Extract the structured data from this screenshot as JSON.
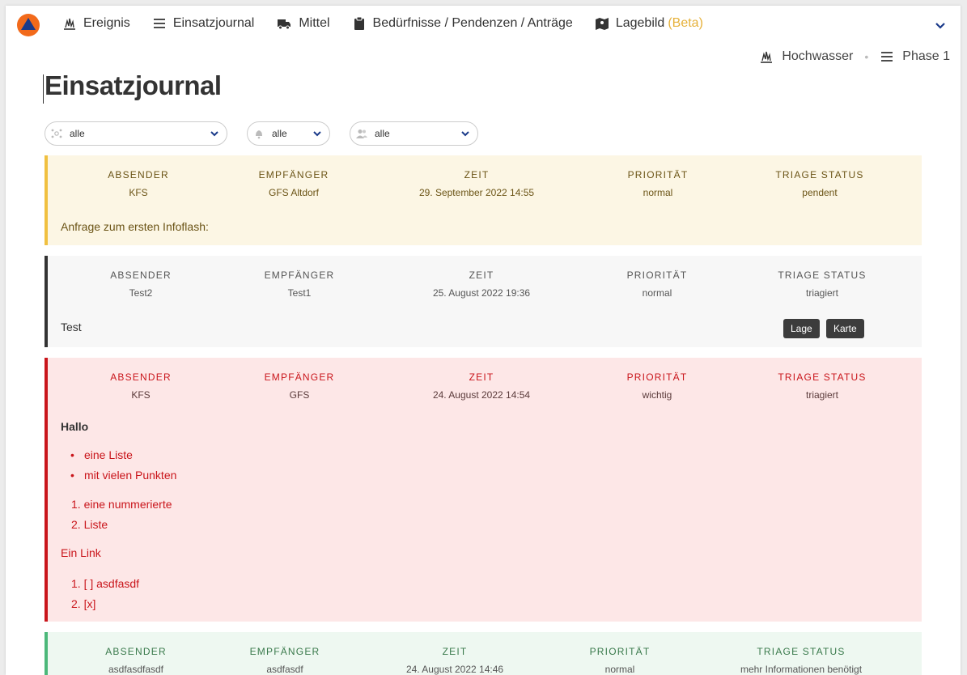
{
  "nav": {
    "items": [
      {
        "label": "Ereignis",
        "icon": "fire-icon"
      },
      {
        "label": "Einsatzjournal",
        "icon": "list-icon"
      },
      {
        "label": "Mittel",
        "icon": "truck-icon"
      },
      {
        "label": "Bedürfnisse / Pendenzen / Anträge",
        "icon": "clipboard-icon"
      },
      {
        "label": "Lagebild",
        "icon": "map-icon",
        "suffix": "(Beta)"
      }
    ]
  },
  "context": {
    "event": "Hochwasser",
    "phase": "Phase 1"
  },
  "page_title": "Einsatzjournal",
  "filters": [
    {
      "icon": "network-icon",
      "value": "alle"
    },
    {
      "icon": "bell-icon",
      "value": "alle"
    },
    {
      "icon": "users-icon",
      "value": "alle"
    }
  ],
  "columns": {
    "sender": "ABSENDER",
    "receiver": "EMPFÄNGER",
    "time": "ZEIT",
    "priority": "PRIORITÄT",
    "triage": "TRIAGE STATUS"
  },
  "entries": [
    {
      "sender": "KFS",
      "receiver": "GFS Altdorf",
      "time": "29. September 2022 14:55",
      "priority": "normal",
      "triage": "pendent",
      "text": "Anfrage zum ersten Infoflash:"
    },
    {
      "sender": "Test2",
      "receiver": "Test1",
      "time": "25. August 2022 19:36",
      "priority": "normal",
      "triage": "triagiert",
      "text": "Test",
      "tags": [
        "Lage",
        "Karte"
      ]
    },
    {
      "sender": "KFS",
      "receiver": "GFS",
      "time": "24. August 2022 14:54",
      "priority": "wichtig",
      "triage": "triagiert",
      "heading": "Hallo",
      "bullets": [
        "eine Liste",
        "mit vielen Punkten"
      ],
      "numbered": [
        "1. eine nummerierte",
        "2. Liste"
      ],
      "link": "Ein Link",
      "tasks": [
        "1. [ ] asdfasdf",
        "2. [x]"
      ]
    },
    {
      "sender": "asdfasdfasdf",
      "receiver": "asdfasdf",
      "time": "24. August 2022 14:46",
      "priority": "normal",
      "triage": "mehr Informationen benötigt"
    }
  ],
  "colors": {
    "yellow_bg": "#fcf6e4",
    "yellow_bar": "#f0c040",
    "grey_bg": "#f7f7f7",
    "grey_bar": "#333333",
    "red_bg": "#fde7e7",
    "red_bar": "#c9151b",
    "green_bg": "#eef8f1",
    "green_bar": "#4cb87a",
    "accent": "#1a3a8a",
    "beta": "#e6b13a"
  }
}
